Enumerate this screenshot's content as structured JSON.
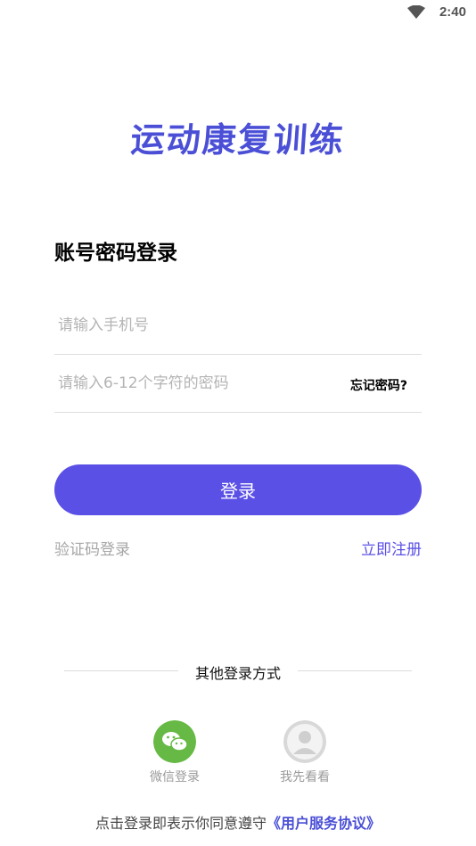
{
  "status_bar": {
    "time": "2:40",
    "wifi_icon": "wifi-icon"
  },
  "app": {
    "title": "运动康复训练"
  },
  "login": {
    "heading": "账号密码登录",
    "phone_placeholder": "请输入手机号",
    "password_placeholder": "请输入6-12个字符的密码",
    "forgot_label": "忘记密码?",
    "submit_label": "登录",
    "sms_login_label": "验证码登录",
    "register_label": "立即注册"
  },
  "other_methods": {
    "label": "其他登录方式",
    "items": [
      {
        "label": "微信登录",
        "icon": "wechat-icon",
        "color": "#66b944"
      },
      {
        "label": "我先看看",
        "icon": "guest-avatar-icon",
        "color": "#d8d8d8"
      }
    ]
  },
  "agreement": {
    "text": "点击登录即表示你同意遵守",
    "link": "《用户服务协议》"
  },
  "colors": {
    "accent": "#5b50e6",
    "logo": "#4a4fd6"
  }
}
